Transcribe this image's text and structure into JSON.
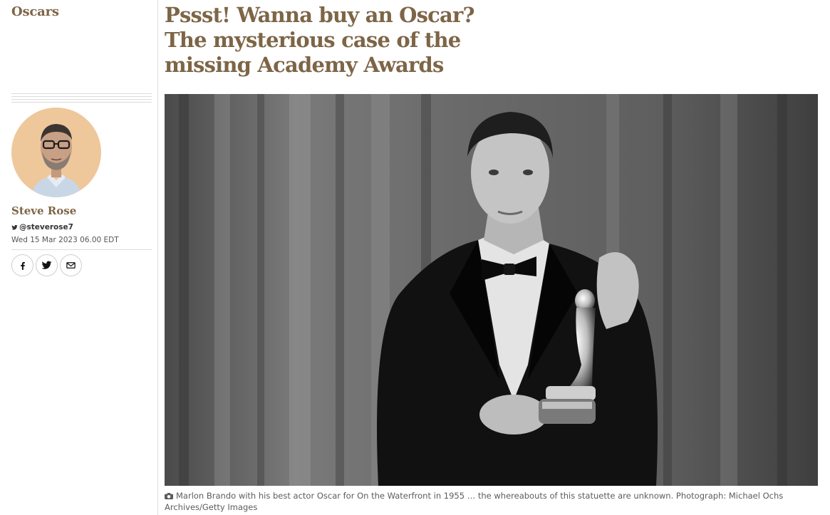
{
  "section": {
    "label": "Oscars"
  },
  "article": {
    "headline": "Pssst! Wanna buy an Oscar? The mysterious case of the missing Academy Awards"
  },
  "author": {
    "name": "Steve Rose",
    "twitter": "@steverose7",
    "published": "Wed 15 Mar 2023 06.00 EDT"
  },
  "share": {
    "buttons": [
      "facebook-icon",
      "twitter-icon",
      "email-icon"
    ]
  },
  "image": {
    "caption": "Marlon Brando with his best actor Oscar for On the Waterfront in 1955 … the whereabouts of this statuette are unknown. Photograph: Michael Ochs Archives/Getty Images"
  },
  "colors": {
    "brand": "#7d6546",
    "avatar_bg": "#eec79b",
    "rule": "#dcdcdc"
  }
}
